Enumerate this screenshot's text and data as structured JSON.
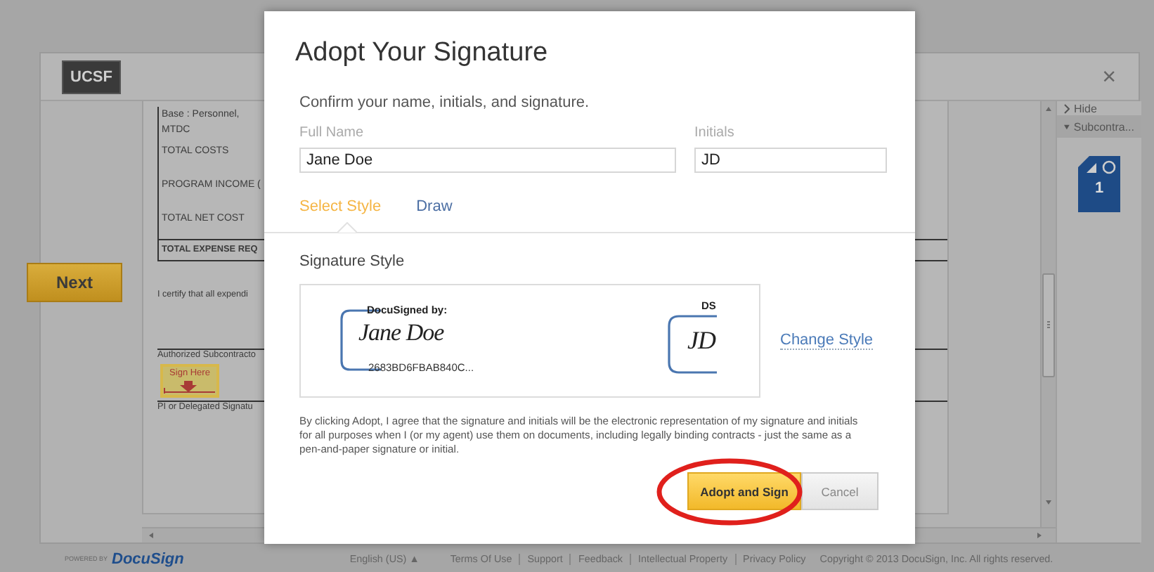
{
  "header": {
    "logo": "UCSF",
    "close": "×"
  },
  "navigator": {
    "label": "Next"
  },
  "document": {
    "lines": [
      {
        "kind": "row-tight",
        "text": "Base :  Personnel,"
      },
      {
        "kind": "row-tight",
        "text": "MTDC"
      },
      {
        "kind": "row",
        "text": "TOTAL COSTS"
      },
      {
        "kind": "row",
        "text": "PROGRAM INCOME ("
      },
      {
        "kind": "row",
        "text": "TOTAL NET COST"
      },
      {
        "kind": "total",
        "text": "TOTAL EXPENSE REQ"
      },
      {
        "kind": "paragraph",
        "text": "I certify that all expendi"
      },
      {
        "kind": "signature",
        "text": "Authorized Subcontracto"
      },
      {
        "kind": "sign-tag",
        "text": "Sign Here"
      },
      {
        "kind": "signature",
        "text": "PI or Delegated Signatu"
      }
    ]
  },
  "panel": {
    "hide": "Hide",
    "section": {
      "label": "Subcontra...",
      "expanded": true
    },
    "page_number": "1"
  },
  "modal": {
    "title": "Adopt Your Signature",
    "subtitle": "Confirm your name, initials, and signature.",
    "fields": [
      {
        "label": "Full Name",
        "value": "Jane Doe"
      },
      {
        "label": "Initials",
        "value": "JD"
      }
    ],
    "tabs": [
      {
        "label": "Select Style",
        "selected": true
      },
      {
        "label": "Draw",
        "selected": false
      }
    ],
    "style_heading": "Signature Style",
    "preview": {
      "caption": "DocuSigned by:",
      "signature": "Jane Doe",
      "hash": "2683BD6FBAB840C...",
      "initials_caption": "DS",
      "initials": "JD"
    },
    "change_style": "Change Style",
    "legal": "By clicking Adopt, I agree that the signature and initials will be the electronic representation of my signature and initials for all purposes when I (or my agent) use them on documents, including legally binding contracts - just the same as a pen-and-paper signature or initial.",
    "buttons": [
      {
        "label": "Adopt and Sign",
        "kind": "primary",
        "circled": true
      },
      {
        "label": "Cancel",
        "kind": "secondary",
        "circled": false
      }
    ]
  },
  "footer": {
    "powered_by": "POWERED BY",
    "brand": "DocuSign",
    "language": "English (US) ▲",
    "links": [
      "Terms Of Use",
      "Support",
      "Feedback",
      "Intellectual Property",
      "Privacy Policy"
    ],
    "copyright": "Copyright © 2013 DocuSign, Inc. All rights reserved."
  }
}
